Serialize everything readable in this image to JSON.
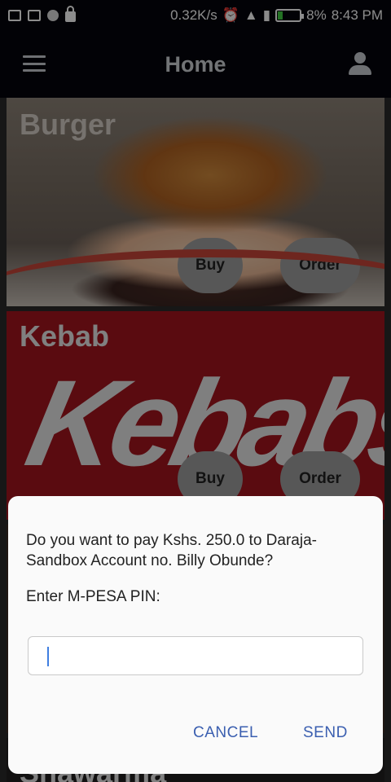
{
  "status_bar": {
    "left_icons": [
      "message-icon",
      "image-icon",
      "circle-icon",
      "lock-icon"
    ],
    "speed": "0.32K/s",
    "right_icons": [
      "alarm-icon",
      "wifi-icon",
      "signal-icon",
      "signal-icon",
      "battery-icon"
    ],
    "battery": "8%",
    "time": "8:43 PM"
  },
  "app_bar": {
    "title": "Home",
    "menu_icon": "menu-icon",
    "profile_icon": "profile-icon"
  },
  "cards": [
    {
      "title": "Burger",
      "buy_label": "Buy",
      "order_label": "Order"
    },
    {
      "title": "Kebab",
      "logo_text": "Kebabs",
      "buy_label": "Buy",
      "order_label": "Order"
    },
    {
      "title": "Shawarma"
    }
  ],
  "dialog": {
    "message": "Do you want to pay Kshs. 250.0 to Daraja-Sandbox Account no. Billy Obunde?",
    "label": "Enter M-PESA PIN:",
    "input_value": "",
    "cancel_label": "CANCEL",
    "send_label": "SEND"
  },
  "colors": {
    "app_bar_bg": "#05050c",
    "kebab_red": "#a5141e",
    "dialog_button": "#3b5fb0",
    "pill_gray": "#9e9e9e"
  }
}
